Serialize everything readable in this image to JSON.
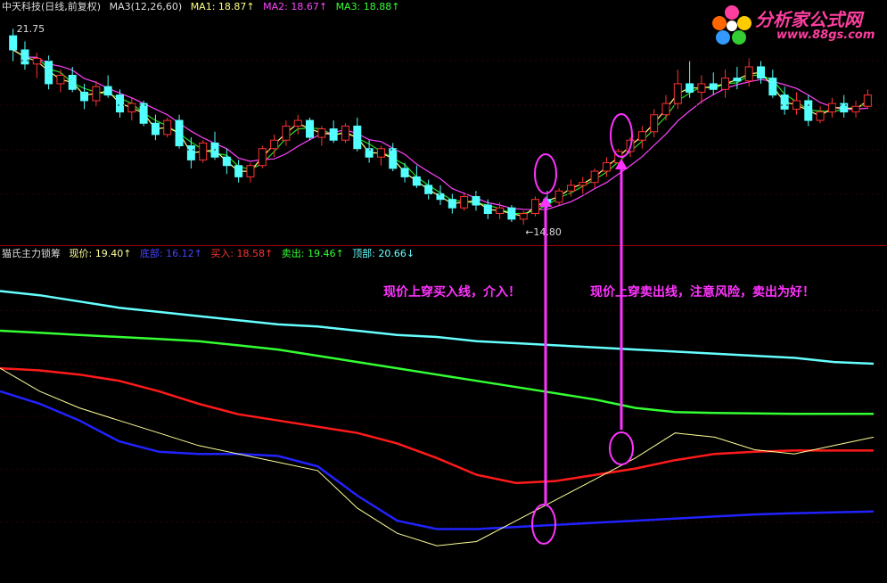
{
  "colors": {
    "background": "#000000",
    "up": "#ff3333",
    "down": "#54ffff",
    "ma1": "#ffff7f",
    "ma2": "#ff44ff",
    "ma3": "#22dd22",
    "price_line": "#ffff99",
    "buy_line": "#ff1a1a",
    "sell_line": "#33ff33",
    "top_line": "#66ffff",
    "bottom_line": "#2222ff",
    "annotation": "#ff33ff"
  },
  "upper_header": {
    "stock": "中天科技(日线,前复权)",
    "ma_label": "MA3(12,26,60)",
    "ma1": "MA1: 18.87↑",
    "ma2": "MA2: 18.67↑",
    "ma3": "MA3: 18.88↑"
  },
  "lower_header": {
    "name": "猫氏主力锁筹",
    "price": "现价: 19.40↑",
    "bottom": "底部: 16.12↑",
    "buy": "买入: 18.58↑",
    "sell": "卖出: 19.46↑",
    "top": "顶部: 20.66↓"
  },
  "logo": {
    "title": "分析家公式网",
    "url": "www.88gs.com"
  },
  "annotations": {
    "buy_note": "现价上穿买入线，介入！",
    "sell_note": "现价上穿卖出线，注意风险，卖出为好！"
  },
  "chart_data": [
    {
      "type": "candlestick",
      "title": "中天科技(日线,前复权)",
      "high_label": "21.75",
      "low_label": "←14.80",
      "ylim": [
        14.3,
        22.2
      ],
      "ohlc": [
        [
          21.5,
          21.75,
          20.6,
          21.0
        ],
        [
          21.0,
          21.3,
          20.3,
          20.5
        ],
        [
          20.5,
          20.9,
          20.0,
          20.7
        ],
        [
          20.6,
          20.8,
          19.6,
          19.8
        ],
        [
          19.8,
          20.3,
          19.5,
          20.1
        ],
        [
          20.1,
          20.4,
          19.5,
          19.6
        ],
        [
          19.5,
          19.8,
          18.9,
          19.2
        ],
        [
          19.2,
          19.9,
          19.0,
          19.7
        ],
        [
          19.7,
          20.1,
          19.3,
          19.4
        ],
        [
          19.4,
          19.6,
          18.6,
          18.8
        ],
        [
          18.8,
          19.3,
          18.5,
          19.1
        ],
        [
          19.1,
          19.2,
          18.3,
          18.4
        ],
        [
          18.4,
          18.7,
          17.8,
          18.0
        ],
        [
          18.0,
          18.6,
          17.9,
          18.5
        ],
        [
          18.5,
          18.7,
          17.5,
          17.6
        ],
        [
          17.6,
          17.9,
          16.8,
          17.1
        ],
        [
          17.1,
          17.8,
          17.0,
          17.7
        ],
        [
          17.7,
          18.1,
          17.1,
          17.2
        ],
        [
          17.2,
          17.5,
          16.6,
          16.9
        ],
        [
          16.9,
          17.1,
          16.3,
          16.5
        ],
        [
          16.5,
          17.0,
          16.3,
          16.9
        ],
        [
          16.9,
          17.6,
          16.8,
          17.5
        ],
        [
          17.5,
          18.0,
          17.2,
          17.8
        ],
        [
          17.8,
          18.5,
          17.6,
          18.3
        ],
        [
          18.3,
          18.7,
          18.0,
          18.5
        ],
        [
          18.5,
          18.6,
          17.8,
          17.9
        ],
        [
          17.9,
          18.3,
          17.6,
          18.2
        ],
        [
          18.2,
          18.5,
          17.7,
          17.8
        ],
        [
          17.8,
          18.4,
          17.7,
          18.3
        ],
        [
          18.3,
          18.6,
          17.4,
          17.5
        ],
        [
          17.5,
          17.8,
          17.0,
          17.2
        ],
        [
          17.2,
          17.6,
          16.9,
          17.5
        ],
        [
          17.5,
          17.7,
          16.7,
          16.8
        ],
        [
          16.8,
          17.0,
          16.3,
          16.5
        ],
        [
          16.5,
          16.9,
          16.1,
          16.2
        ],
        [
          16.2,
          16.4,
          15.7,
          15.9
        ],
        [
          15.9,
          16.2,
          15.5,
          15.7
        ],
        [
          15.7,
          15.9,
          15.2,
          15.4
        ],
        [
          15.4,
          15.9,
          15.3,
          15.8
        ],
        [
          15.8,
          16.0,
          15.3,
          15.5
        ],
        [
          15.5,
          15.7,
          15.0,
          15.2
        ],
        [
          15.2,
          15.6,
          15.0,
          15.4
        ],
        [
          15.4,
          15.5,
          14.9,
          15.0
        ],
        [
          15.0,
          15.3,
          14.8,
          15.2
        ],
        [
          15.2,
          15.8,
          15.1,
          15.7
        ],
        [
          15.7,
          16.0,
          15.4,
          15.6
        ],
        [
          15.6,
          16.1,
          15.5,
          16.0
        ],
        [
          16.0,
          16.4,
          15.8,
          16.2
        ],
        [
          16.2,
          16.5,
          15.9,
          16.3
        ],
        [
          16.3,
          16.8,
          16.1,
          16.7
        ],
        [
          16.7,
          17.2,
          16.5,
          17.0
        ],
        [
          17.0,
          17.5,
          16.8,
          17.4
        ],
        [
          17.4,
          17.9,
          17.2,
          17.8
        ],
        [
          17.8,
          18.3,
          17.5,
          18.1
        ],
        [
          18.1,
          18.9,
          17.9,
          18.7
        ],
        [
          18.7,
          19.4,
          18.5,
          19.1
        ],
        [
          19.1,
          20.3,
          18.9,
          19.8
        ],
        [
          19.8,
          20.6,
          19.3,
          19.5
        ],
        [
          19.5,
          20.1,
          19.1,
          19.8
        ],
        [
          19.8,
          20.2,
          19.4,
          19.6
        ],
        [
          19.6,
          20.3,
          19.3,
          20.0
        ],
        [
          20.0,
          20.4,
          19.6,
          19.9
        ],
        [
          19.9,
          20.7,
          19.7,
          20.4
        ],
        [
          20.4,
          20.6,
          19.8,
          20.0
        ],
        [
          20.0,
          20.3,
          19.3,
          19.4
        ],
        [
          19.4,
          19.7,
          18.7,
          18.9
        ],
        [
          18.9,
          19.5,
          18.7,
          19.2
        ],
        [
          19.2,
          19.4,
          18.3,
          18.5
        ],
        [
          18.5,
          19.0,
          18.4,
          18.8
        ],
        [
          18.8,
          19.3,
          18.6,
          19.1
        ],
        [
          19.1,
          19.4,
          18.6,
          18.8
        ],
        [
          18.8,
          19.2,
          18.6,
          19.0
        ],
        [
          19.0,
          19.6,
          18.9,
          19.4
        ]
      ]
    },
    {
      "type": "line",
      "title": "猫氏主力锁筹",
      "ylim": [
        15.6,
        23.2
      ],
      "series": [
        {
          "name": "顶部",
          "values": [
            22.4,
            22.3,
            22.15,
            22.0,
            21.9,
            21.8,
            21.7,
            21.6,
            21.55,
            21.45,
            21.35,
            21.3,
            21.2,
            21.15,
            21.1,
            21.05,
            21.0,
            20.95,
            20.9,
            20.85,
            20.8,
            20.7,
            20.66
          ]
        },
        {
          "name": "卖出",
          "values": [
            21.45,
            21.4,
            21.35,
            21.3,
            21.25,
            21.2,
            21.1,
            21.0,
            20.85,
            20.7,
            20.55,
            20.4,
            20.25,
            20.1,
            19.95,
            19.8,
            19.6,
            19.5,
            19.48,
            19.47,
            19.46,
            19.46,
            19.46
          ]
        },
        {
          "name": "买入",
          "values": [
            20.55,
            20.5,
            20.4,
            20.25,
            20.0,
            19.7,
            19.45,
            19.3,
            19.15,
            19.0,
            18.75,
            18.4,
            18.0,
            17.8,
            17.85,
            18.0,
            18.15,
            18.35,
            18.5,
            18.55,
            18.58,
            18.58,
            18.58
          ]
        },
        {
          "name": "底部",
          "values": [
            20.0,
            19.7,
            19.3,
            18.8,
            18.55,
            18.5,
            18.5,
            18.45,
            18.2,
            17.5,
            16.9,
            16.7,
            16.7,
            16.75,
            16.8,
            16.85,
            16.9,
            16.95,
            17.0,
            17.05,
            17.08,
            17.1,
            17.12
          ]
        },
        {
          "name": "现价",
          "values": [
            20.55,
            20.0,
            19.6,
            19.3,
            19.0,
            18.7,
            18.5,
            18.3,
            18.1,
            17.2,
            16.6,
            16.3,
            16.4,
            16.9,
            17.4,
            17.9,
            18.4,
            19.0,
            18.9,
            18.6,
            18.5,
            18.7,
            18.9
          ]
        }
      ]
    }
  ]
}
